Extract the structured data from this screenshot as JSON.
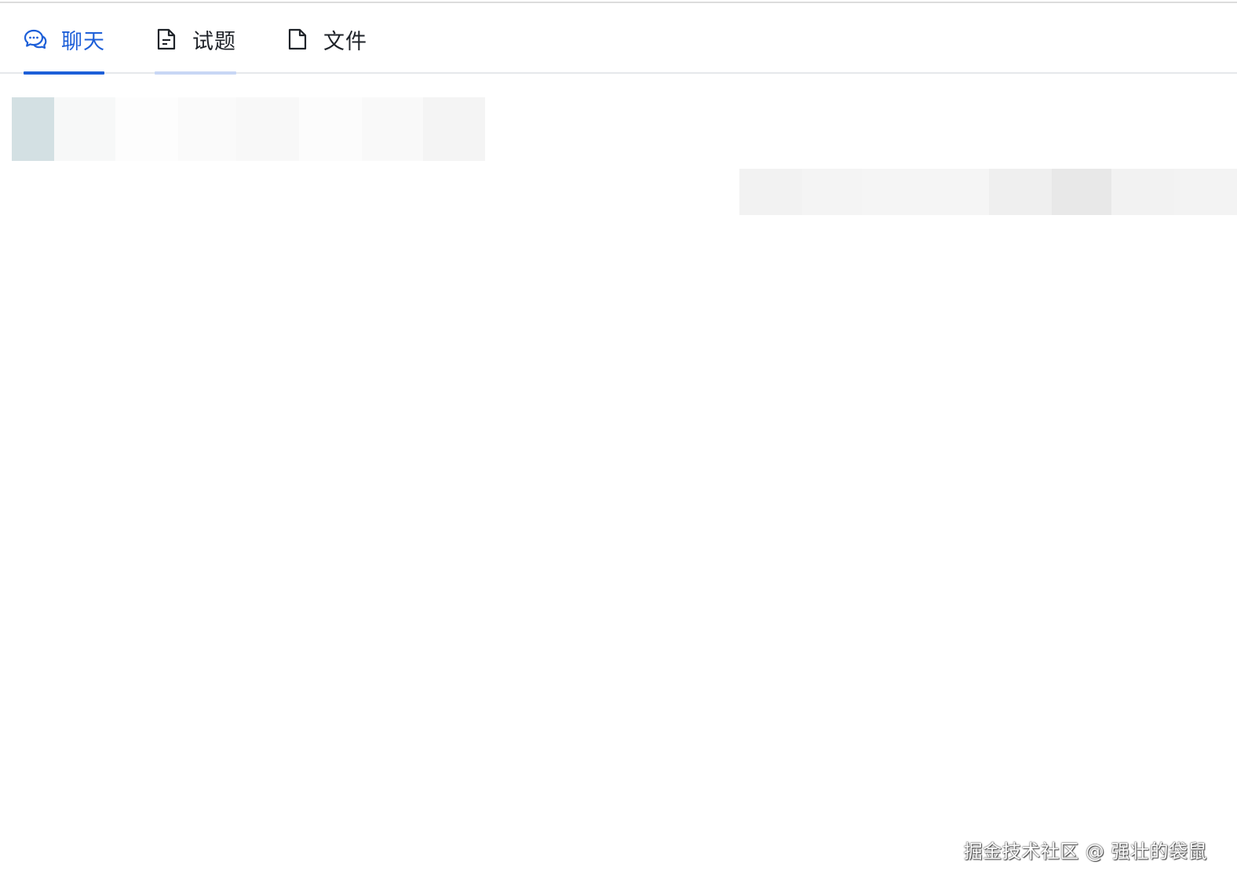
{
  "tabs": [
    {
      "label": "聊天",
      "icon": "chat-bubbles-icon",
      "active": true
    },
    {
      "label": "试题",
      "icon": "document-lines-icon",
      "active": false
    },
    {
      "label": "文件",
      "icon": "file-icon",
      "active": false
    }
  ],
  "colors": {
    "accent": "#1d5fd8",
    "text": "#1f2329",
    "divider": "#e6e8eb"
  },
  "watermark": "掘金技术社区 @ 强壮的袋鼠"
}
